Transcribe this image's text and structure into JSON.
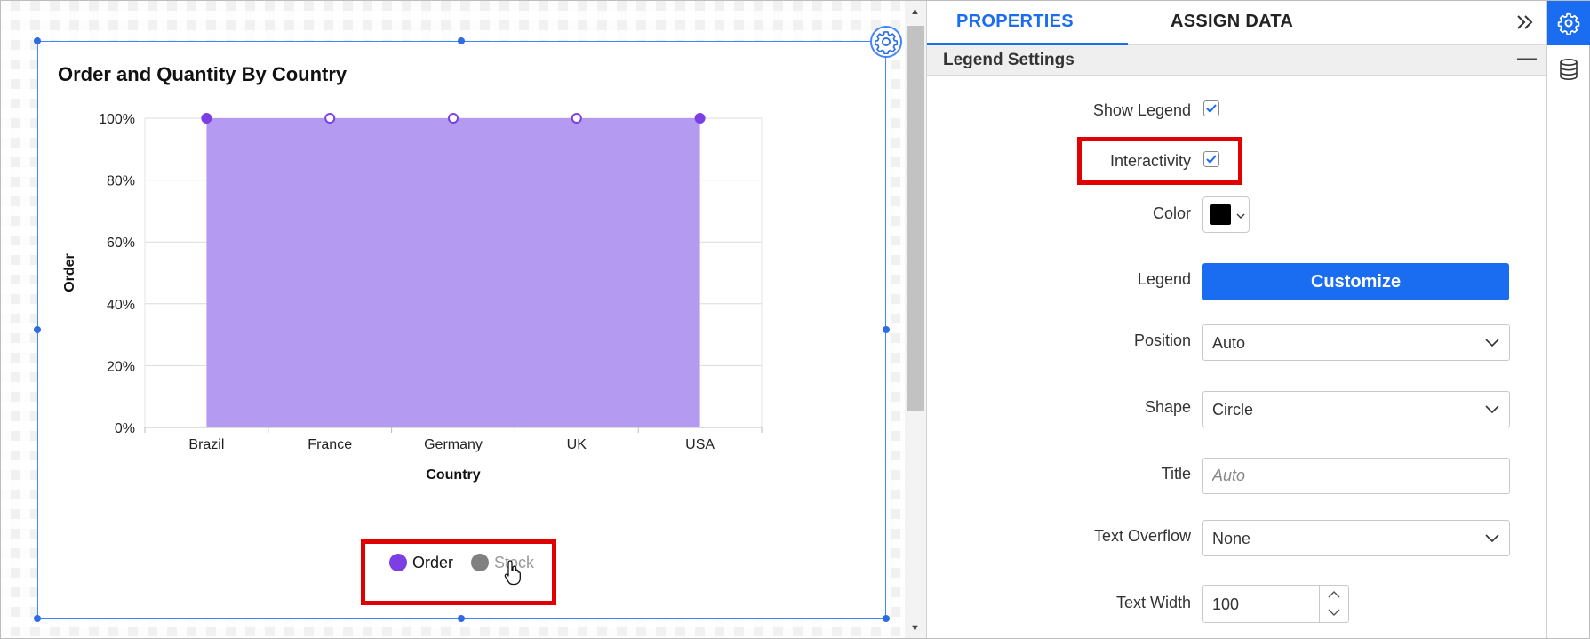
{
  "chart": {
    "title": "Order and Quantity By Country"
  },
  "chart_data": {
    "type": "area",
    "title": "Order and Quantity By Country",
    "xlabel": "Country",
    "ylabel": "Order",
    "categories": [
      "Brazil",
      "France",
      "Germany",
      "UK",
      "USA"
    ],
    "yticks": [
      "0%",
      "20%",
      "40%",
      "60%",
      "80%",
      "100%"
    ],
    "ylim": [
      0,
      100
    ],
    "grid": true,
    "legend_position": "bottom",
    "series": [
      {
        "name": "Order",
        "values": [
          100,
          100,
          100,
          100,
          100
        ],
        "color": "#7b3fe4",
        "fill": "#b49af0",
        "visible": true
      },
      {
        "name": "Stock",
        "values": [],
        "color": "#808080",
        "visible": false
      }
    ]
  },
  "panel": {
    "tabs": [
      {
        "label": "PROPERTIES",
        "active": true
      },
      {
        "label": "ASSIGN DATA",
        "active": false
      }
    ],
    "section_title": "Legend Settings",
    "section_toggle": "—",
    "fields": {
      "show_legend": {
        "label": "Show Legend",
        "checked": true
      },
      "interactivity": {
        "label": "Interactivity",
        "checked": true
      },
      "color": {
        "label": "Color",
        "value": "#000000"
      },
      "legend": {
        "label": "Legend",
        "button": "Customize"
      },
      "position": {
        "label": "Position",
        "value": "Auto"
      },
      "shape": {
        "label": "Shape",
        "value": "Circle"
      },
      "title": {
        "label": "Title",
        "placeholder": "Auto"
      },
      "text_overflow": {
        "label": "Text Overflow",
        "value": "None"
      },
      "text_width": {
        "label": "Text Width",
        "value": "100"
      }
    }
  },
  "colors": {
    "accent": "#1a6cf0",
    "highlight": "#e00000",
    "area_fill": "#b49af0",
    "order": "#7b3fe4",
    "stock": "#808080"
  },
  "icons": {
    "rail": [
      "gear-icon",
      "database-icon"
    ],
    "widget_settings": "gear-icon",
    "panel_collapse": "double-chevron-right-icon"
  }
}
